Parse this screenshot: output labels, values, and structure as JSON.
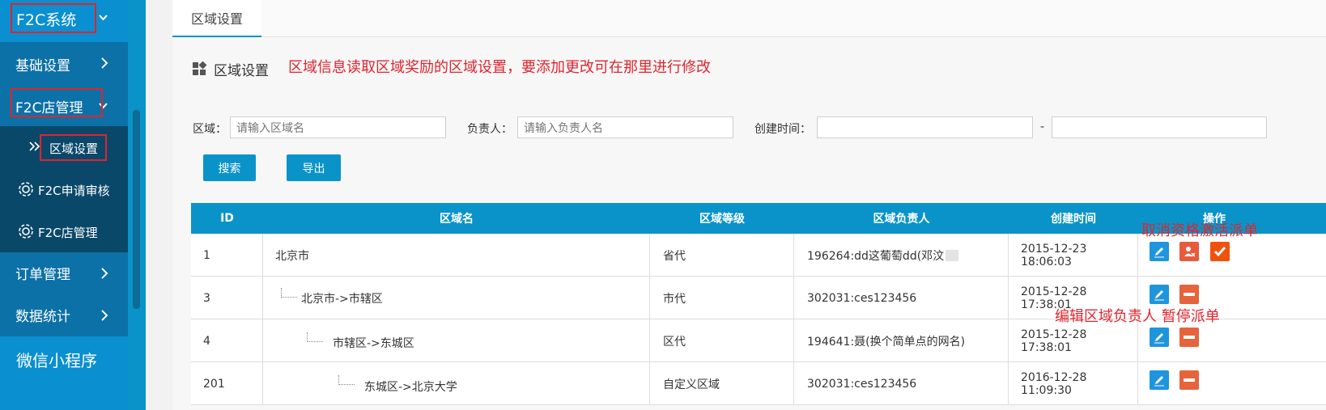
{
  "sidebar": {
    "system_title": "F2C系统",
    "items": [
      {
        "label": "基础设置"
      },
      {
        "label": "F2C店管理"
      },
      {
        "label": "区域设置"
      },
      {
        "label": "F2C申请审核"
      },
      {
        "label": "F2C店管理"
      },
      {
        "label": "订单管理"
      },
      {
        "label": "数据统计"
      },
      {
        "label": "微信小程序"
      }
    ]
  },
  "tab": {
    "label": "区域设置"
  },
  "page": {
    "title": "区域设置",
    "annotation_top": "区域信息读取区域奖励的区域设置，要添加更改可在那里进行修改",
    "annotation_ops": "取消资格激活派单",
    "annotation_edit": "编辑区域负责人  暂停派单"
  },
  "filters": {
    "region_label": "区域：",
    "region_placeholder": "请输入区域名",
    "owner_label": "负责人：",
    "owner_placeholder": "请输入负责人名",
    "created_label": "创建时间：",
    "range_sep": "-"
  },
  "buttons": {
    "search": "搜索",
    "export": "导出"
  },
  "table": {
    "headers": [
      "ID",
      "区域名",
      "区域等级",
      "区域负责人",
      "创建时间",
      "操作"
    ],
    "rows": [
      {
        "id": "1",
        "name": "北京市",
        "level": "省代",
        "owner": "196264:dd这葡萄dd(邓汶",
        "created_date": "2015-12-23",
        "created_time": "18:06:03"
      },
      {
        "id": "3",
        "name": "北京市->市辖区",
        "level": "市代",
        "owner": "302031:ces123456",
        "created_date": "2015-12-28",
        "created_time": "17:38:01"
      },
      {
        "id": "4",
        "name": "市辖区->东城区",
        "level": "区代",
        "owner": "194641:聂(换个简单点的网名)",
        "created_date": "2015-12-28",
        "created_time": "17:38:01"
      },
      {
        "id": "201",
        "name": "东城区->北京大学",
        "level": "自定义区域",
        "owner": "302031:ces123456",
        "created_date": "2016-12-28",
        "created_time": "11:09:30"
      }
    ]
  },
  "icons": [
    "chevron-right-icon",
    "chevron-down-icon",
    "gear-icon",
    "double-chevron-icon",
    "grid-icon",
    "edit-icon",
    "cancel-user-icon",
    "check-icon",
    "minus-icon"
  ],
  "colors": {
    "accent": "#0a93c9",
    "annotation": "#e0242e",
    "sidebar_dark": "#0e4f72"
  }
}
